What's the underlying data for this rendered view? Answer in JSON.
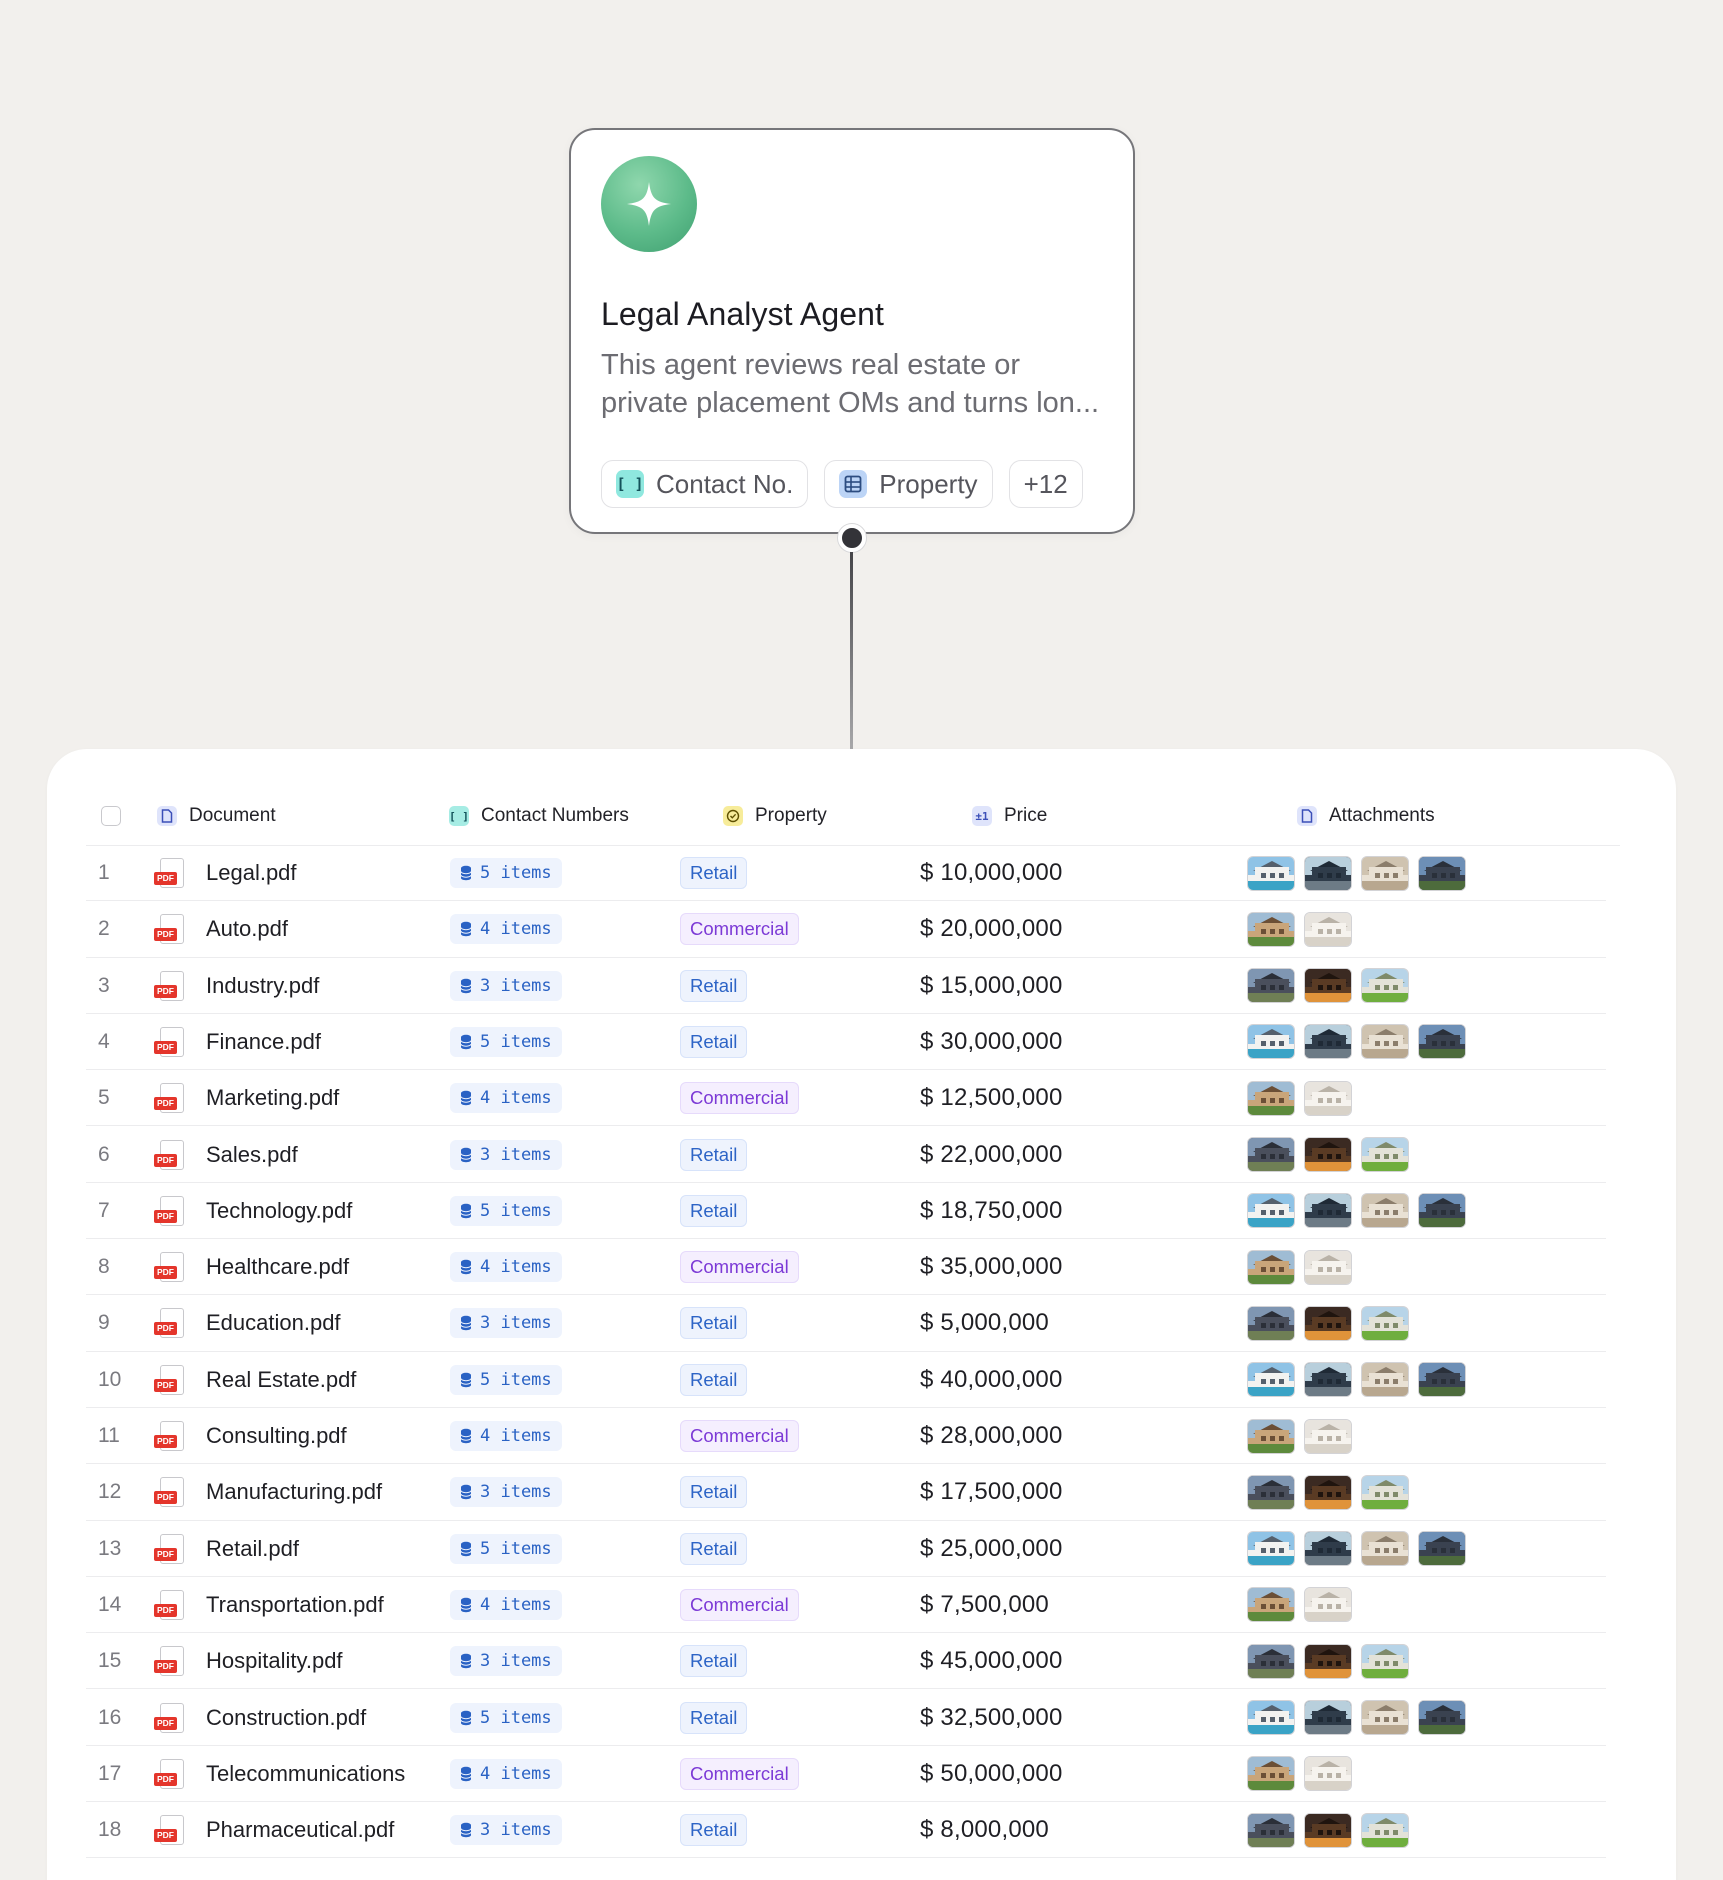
{
  "agent": {
    "title": "Legal Analyst Agent",
    "description_line1": "This agent reviews real estate or",
    "description_line2": "private placement OMs and turns lon...",
    "chips": [
      {
        "icon": "bracket-icon",
        "label": "Contact No."
      },
      {
        "icon": "table-icon",
        "label": "Property"
      },
      {
        "label": "+12"
      }
    ]
  },
  "table": {
    "headers": {
      "document": "Document",
      "contact_numbers": "Contact Numbers",
      "property": "Property",
      "price": "Price",
      "attachments": "Attachments"
    },
    "rows": [
      {
        "num": "1",
        "doc": "Legal.pdf",
        "contacts": "5 items",
        "property": "Retail",
        "price": "$ 10,000,000",
        "attachments": 4,
        "set": "a"
      },
      {
        "num": "2",
        "doc": "Auto.pdf",
        "contacts": "4 items",
        "property": "Commercial",
        "price": "$ 20,000,000",
        "attachments": 2,
        "set": "b"
      },
      {
        "num": "3",
        "doc": "Industry.pdf",
        "contacts": "3 items",
        "property": "Retail",
        "price": "$ 15,000,000",
        "attachments": 3,
        "set": "c"
      },
      {
        "num": "4",
        "doc": "Finance.pdf",
        "contacts": "5 items",
        "property": "Retail",
        "price": "$ 30,000,000",
        "attachments": 4,
        "set": "a"
      },
      {
        "num": "5",
        "doc": "Marketing.pdf",
        "contacts": "4 items",
        "property": "Commercial",
        "price": "$ 12,500,000",
        "attachments": 2,
        "set": "b"
      },
      {
        "num": "6",
        "doc": "Sales.pdf",
        "contacts": "3 items",
        "property": "Retail",
        "price": "$ 22,000,000",
        "attachments": 3,
        "set": "c"
      },
      {
        "num": "7",
        "doc": "Technology.pdf",
        "contacts": "5 items",
        "property": "Retail",
        "price": "$ 18,750,000",
        "attachments": 4,
        "set": "a"
      },
      {
        "num": "8",
        "doc": "Healthcare.pdf",
        "contacts": "4 items",
        "property": "Commercial",
        "price": "$ 35,000,000",
        "attachments": 2,
        "set": "b"
      },
      {
        "num": "9",
        "doc": "Education.pdf",
        "contacts": "3 items",
        "property": "Retail",
        "price": "$ 5,000,000",
        "attachments": 3,
        "set": "c"
      },
      {
        "num": "10",
        "doc": "Real Estate.pdf",
        "contacts": "5 items",
        "property": "Retail",
        "price": "$ 40,000,000",
        "attachments": 4,
        "set": "a"
      },
      {
        "num": "11",
        "doc": "Consulting.pdf",
        "contacts": "4 items",
        "property": "Commercial",
        "price": "$ 28,000,000",
        "attachments": 2,
        "set": "b"
      },
      {
        "num": "12",
        "doc": "Manufacturing.pdf",
        "contacts": "3 items",
        "property": "Retail",
        "price": "$ 17,500,000",
        "attachments": 3,
        "set": "c"
      },
      {
        "num": "13",
        "doc": "Retail.pdf",
        "contacts": "5 items",
        "property": "Retail",
        "price": "$ 25,000,000",
        "attachments": 4,
        "set": "a"
      },
      {
        "num": "14",
        "doc": "Transportation.pdf",
        "contacts": "4 items",
        "property": "Commercial",
        "price": "$ 7,500,000",
        "attachments": 2,
        "set": "b"
      },
      {
        "num": "15",
        "doc": "Hospitality.pdf",
        "contacts": "3 items",
        "property": "Retail",
        "price": "$ 45,000,000",
        "attachments": 3,
        "set": "c"
      },
      {
        "num": "16",
        "doc": "Construction.pdf",
        "contacts": "5 items",
        "property": "Retail",
        "price": "$ 32,500,000",
        "attachments": 4,
        "set": "a"
      },
      {
        "num": "17",
        "doc": "Telecommunications",
        "contacts": "4 items",
        "property": "Commercial",
        "price": "$ 50,000,000",
        "attachments": 2,
        "set": "b"
      },
      {
        "num": "18",
        "doc": "Pharmaceutical.pdf",
        "contacts": "3 items",
        "property": "Retail",
        "price": "$ 8,000,000",
        "attachments": 3,
        "set": "c"
      }
    ]
  },
  "colors": {
    "background": "#f2f0ed",
    "agent_accent": "#5dbb8a",
    "retail": "#2d64c6",
    "commercial": "#7c3ad6",
    "pdf_tag": "#e4352b"
  }
}
